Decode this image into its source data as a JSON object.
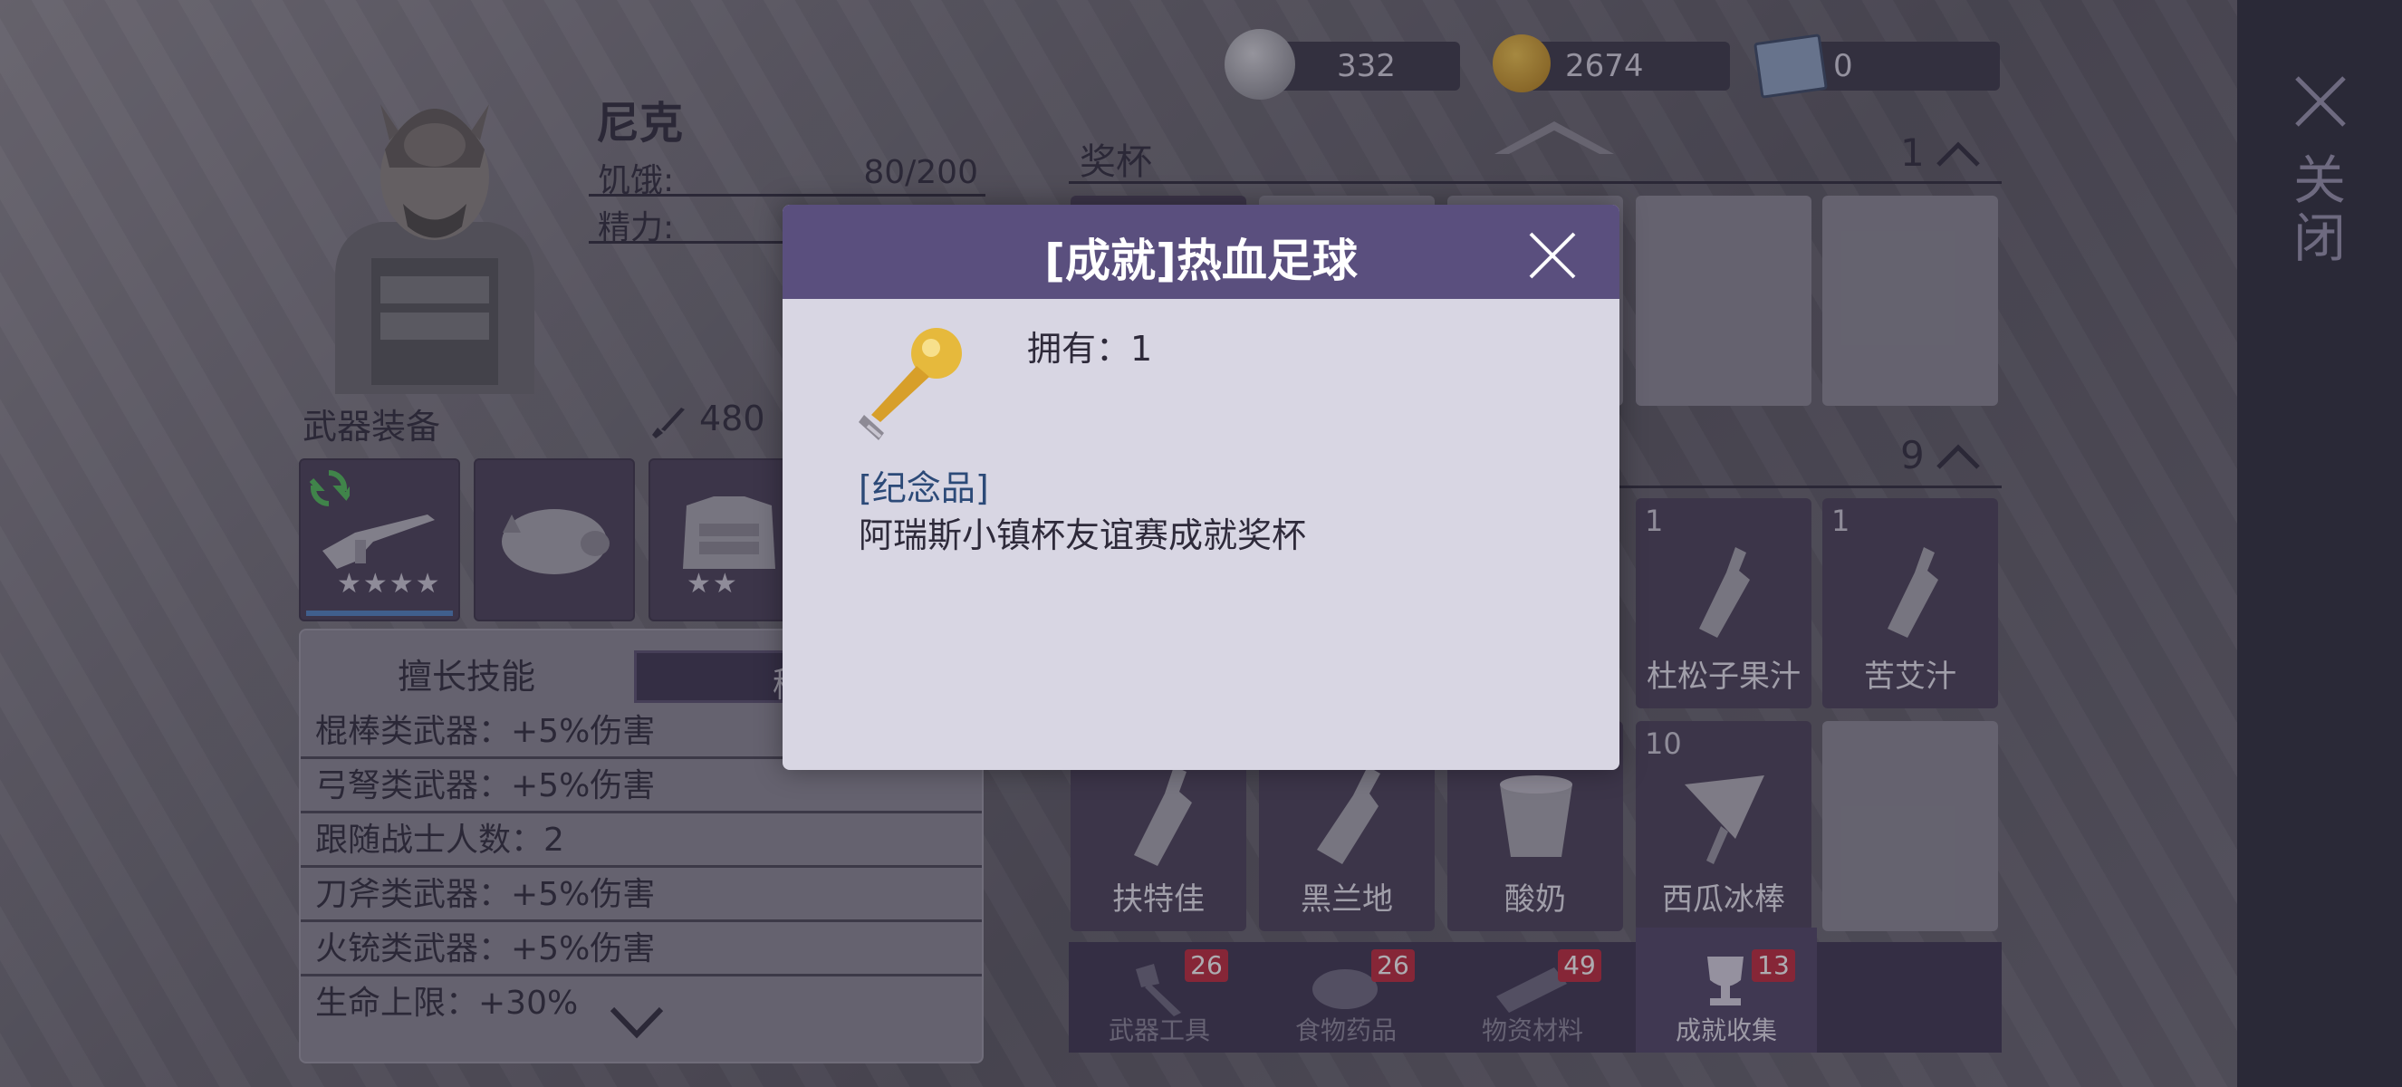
{
  "character": {
    "name": "尼克",
    "stats": [
      {
        "label": "饥饿:",
        "value": "80/200"
      },
      {
        "label": "精力:",
        "value": ""
      }
    ]
  },
  "weapons": {
    "title": "武器装备",
    "power": "480",
    "slots": [
      {
        "icon": "rifle-icon",
        "stars": "★★★★"
      },
      {
        "icon": "boar-mask-icon",
        "stars": ""
      },
      {
        "icon": "vest-icon",
        "stars": "★★"
      }
    ]
  },
  "skills": {
    "tab_active": "擅长技能",
    "tab_other": "稀",
    "rows": [
      "棍棒类武器：+5%伤害",
      "弓弩类武器：+5%伤害",
      "跟随战士人数：2",
      "刀斧类武器：+5%伤害",
      "火铳类武器：+5%伤害",
      "生命上限：+30%"
    ]
  },
  "currency": [
    {
      "icon": "silver-coin-icon",
      "value": "332"
    },
    {
      "icon": "gold-coin-icon",
      "value": "2674"
    },
    {
      "icon": "ticket-icon",
      "value": "0"
    }
  ],
  "trophies": {
    "title": "奖杯",
    "count": "1"
  },
  "collection": {
    "count": "9",
    "row1": [
      {
        "qty": "1",
        "name": "杜松子果汁"
      },
      {
        "qty": "1",
        "name": "苦艾汁"
      }
    ],
    "row2": [
      {
        "qty": "",
        "name": "扶特佳"
      },
      {
        "qty": "",
        "name": "黑兰地"
      },
      {
        "qty": "",
        "name": "酸奶"
      },
      {
        "qty": "10",
        "name": "西瓜冰棒"
      }
    ]
  },
  "tabs": [
    {
      "label": "武器工具",
      "badge": "26",
      "icon": "axe-icon"
    },
    {
      "label": "食物药品",
      "badge": "26",
      "icon": "meat-icon"
    },
    {
      "label": "物资材料",
      "badge": "49",
      "icon": "log-icon"
    },
    {
      "label": "成就收集",
      "badge": "13",
      "icon": "trophy-icon"
    }
  ],
  "close_panel": {
    "label": "关闭"
  },
  "modal": {
    "title": "[成就]热血足球",
    "own": "拥有：1",
    "tag": "[纪念品]",
    "desc": "阿瑞斯小镇杯友谊赛成就奖杯"
  },
  "colors": {
    "modal_header": "#5a4f7e",
    "tag": "#2c4a78",
    "badge": "#c0283a"
  }
}
